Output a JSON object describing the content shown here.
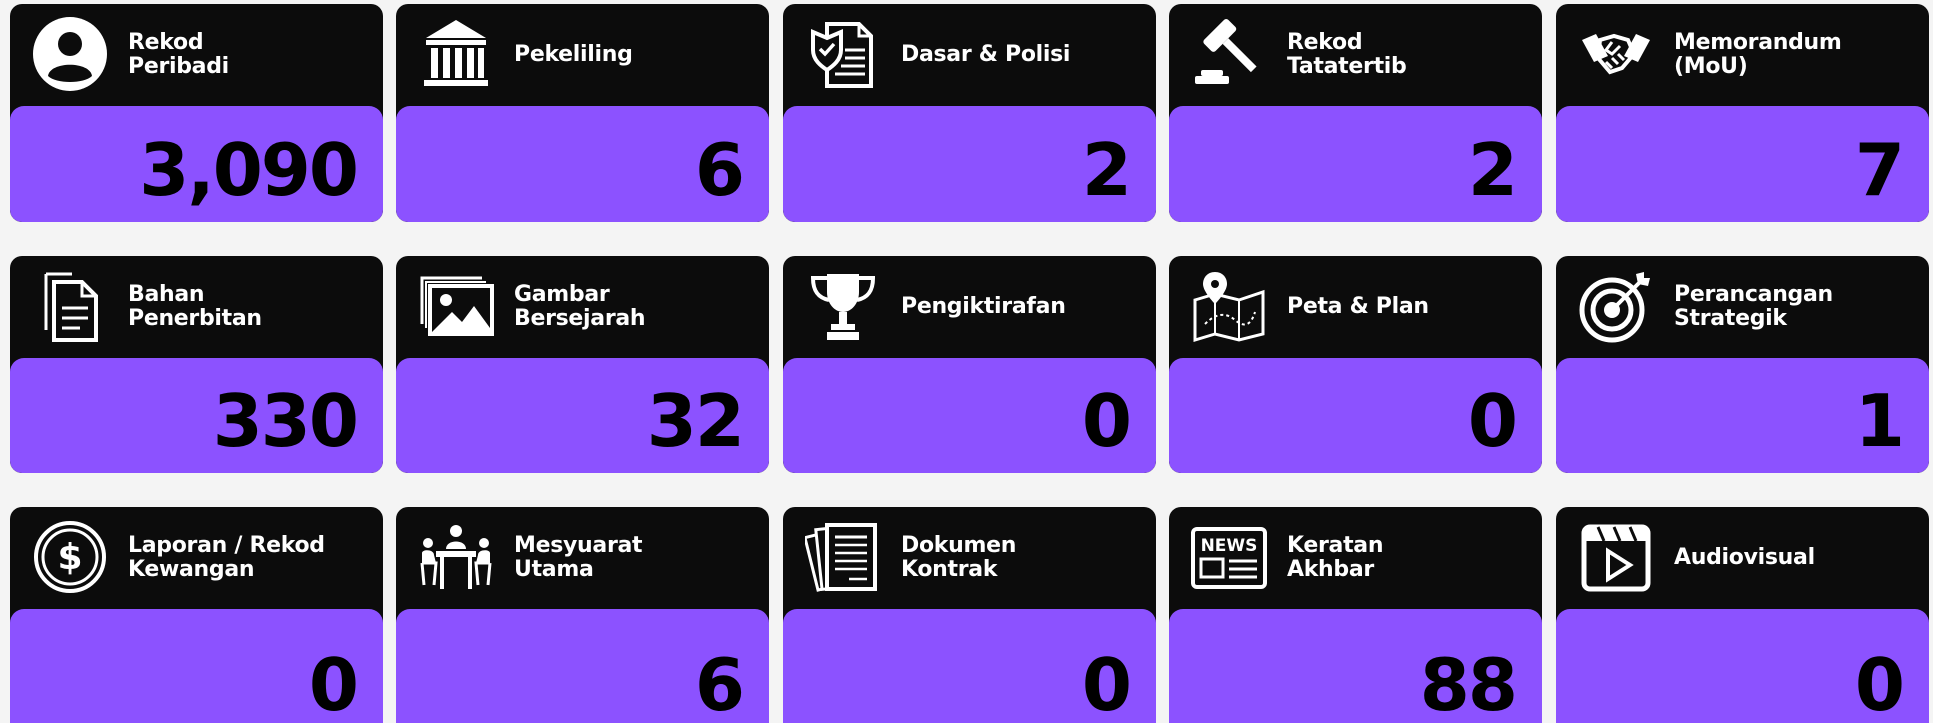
{
  "colors": {
    "header_bg": "#0c0c0c",
    "value_bg": "#8c52ff",
    "header_text": "#ffffff",
    "value_text": "#000000",
    "page_bg": "#f4f4f4"
  },
  "cards": [
    {
      "title": "Rekod\nPeribadi",
      "value": "3,090",
      "icon": "person-icon"
    },
    {
      "title": "Pekeliling",
      "value": "6",
      "icon": "building-icon"
    },
    {
      "title": "Dasar & Polisi",
      "value": "2",
      "icon": "policy-shield-icon"
    },
    {
      "title": "Rekod\nTatatertib",
      "value": "2",
      "icon": "gavel-icon"
    },
    {
      "title": "Memorandum\n(MoU)",
      "value": "7",
      "icon": "handshake-icon"
    },
    {
      "title": "Bahan\nPenerbitan",
      "value": "330",
      "icon": "document-icon"
    },
    {
      "title": "Gambar\nBersejarah",
      "value": "32",
      "icon": "image-icon"
    },
    {
      "title": "Pengiktirafan",
      "value": "0",
      "icon": "trophy-icon"
    },
    {
      "title": "Peta & Plan",
      "value": "0",
      "icon": "map-icon"
    },
    {
      "title": "Perancangan\nStrategik",
      "value": "1",
      "icon": "target-icon"
    },
    {
      "title": "Laporan / Rekod\nKewangan",
      "value": "0",
      "icon": "dollar-icon"
    },
    {
      "title": "Mesyuarat\nUtama",
      "value": "6",
      "icon": "meeting-icon"
    },
    {
      "title": "Dokumen\nKontrak",
      "value": "0",
      "icon": "contract-icon"
    },
    {
      "title": "Keratan\nAkhbar",
      "value": "88",
      "icon": "newspaper-icon"
    },
    {
      "title": "Audiovisual",
      "value": "0",
      "icon": "video-icon"
    }
  ]
}
